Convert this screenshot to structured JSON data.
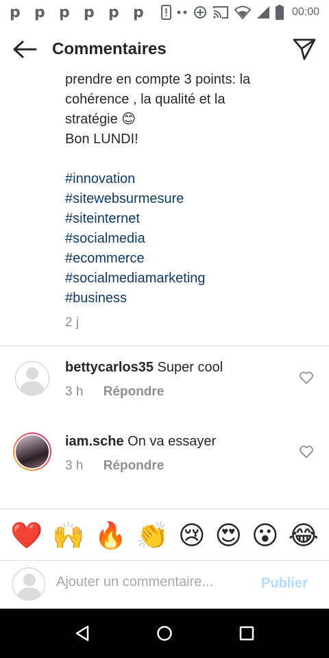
{
  "status_bar": {
    "time": "00:00",
    "notification_icons": [
      "p",
      "p",
      "p",
      "p",
      "p",
      "p"
    ]
  },
  "header": {
    "title": "Commentaires"
  },
  "caption": {
    "lines": [
      "prendre en compte 3 points: la",
      "cohérence , la qualité et la",
      "stratégie 😊",
      "Bon LUNDI!",
      ""
    ],
    "hashtags": [
      "#innovation",
      "#sitewebsurmesure",
      "#siteinternet",
      "#socialmedia",
      "#ecommerce",
      "#socialmediamarketing",
      "#business"
    ],
    "time": "2 j"
  },
  "comments": [
    {
      "username": "bettycarlos35",
      "text": "Super cool",
      "time": "3 h",
      "reply_label": "Répondre",
      "avatar": "default-avatar"
    },
    {
      "username": "iam.sche",
      "text": "On va essayer",
      "time": "3 h",
      "reply_label": "Répondre",
      "avatar": "story-ring-avatar"
    }
  ],
  "emoji_bar": [
    "❤️",
    "🙌",
    "🔥",
    "👏",
    "😢",
    "😍",
    "😮",
    "😂"
  ],
  "composer": {
    "placeholder": "Ajouter un commentaire...",
    "publish_label": "Publier"
  },
  "colors": {
    "hashtag": "#0f3a63",
    "publish_disabled": "#b3dbff",
    "muted_text": "#8e8e8e",
    "nav_bar": "#000000"
  }
}
